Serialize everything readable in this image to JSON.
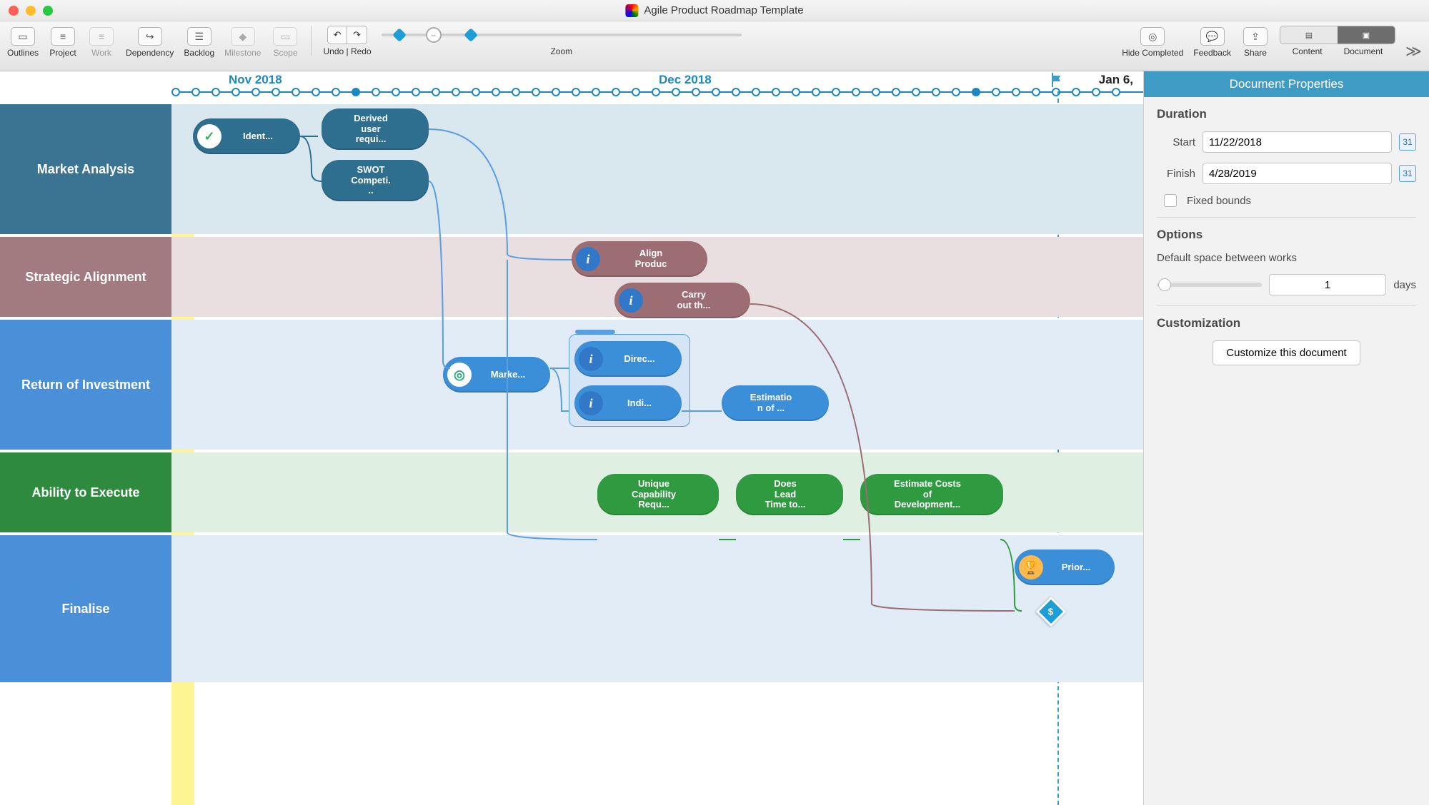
{
  "window": {
    "title": "Agile Product Roadmap Template"
  },
  "toolbar": {
    "outlines": "Outlines",
    "project": "Project",
    "work": "Work",
    "dependency": "Dependency",
    "backlog": "Backlog",
    "milestone": "Milestone",
    "scope": "Scope",
    "undo_redo": "Undo | Redo",
    "zoom": "Zoom",
    "hide_completed": "Hide Completed",
    "feedback": "Feedback",
    "share": "Share",
    "content": "Content",
    "document": "Document"
  },
  "timeline": {
    "month1": "Nov 2018",
    "month2": "Dec 2018",
    "marker_date": "Jan 6,"
  },
  "lanes": {
    "l1": "Market Analysis",
    "l2": "Strategic Alignment",
    "l3": "Return of Investment",
    "l4": "Ability to Execute",
    "l5": "Finalise"
  },
  "tasks": {
    "ident": "Ident...",
    "derived": "Derived\nuser\nrequi...",
    "swot": "SWOT\nCompeti.\n..",
    "align": "Align\nProduc",
    "carry": "Carry\nout th...",
    "marke": "Marke...",
    "direc": "Direc...",
    "indi": "Indi...",
    "estim": "Estimatio\nn of ...",
    "unique": "Unique\nCapability\nRequ...",
    "lead": "Does\nLead\nTime to...",
    "costs": "Estimate Costs\nof\nDevelopment...",
    "prior": "Prior..."
  },
  "milestone_symbol": "$",
  "inspector": {
    "title": "Document Properties",
    "duration_h": "Duration",
    "start_l": "Start",
    "finish_l": "Finish",
    "start_v": "11/22/2018",
    "finish_v": "4/28/2019",
    "fixed_bounds": "Fixed bounds",
    "options_h": "Options",
    "spacing_l": "Default space between works",
    "spacing_v": "1",
    "spacing_unit": "days",
    "custom_h": "Customization",
    "custom_btn": "Customize this document"
  }
}
